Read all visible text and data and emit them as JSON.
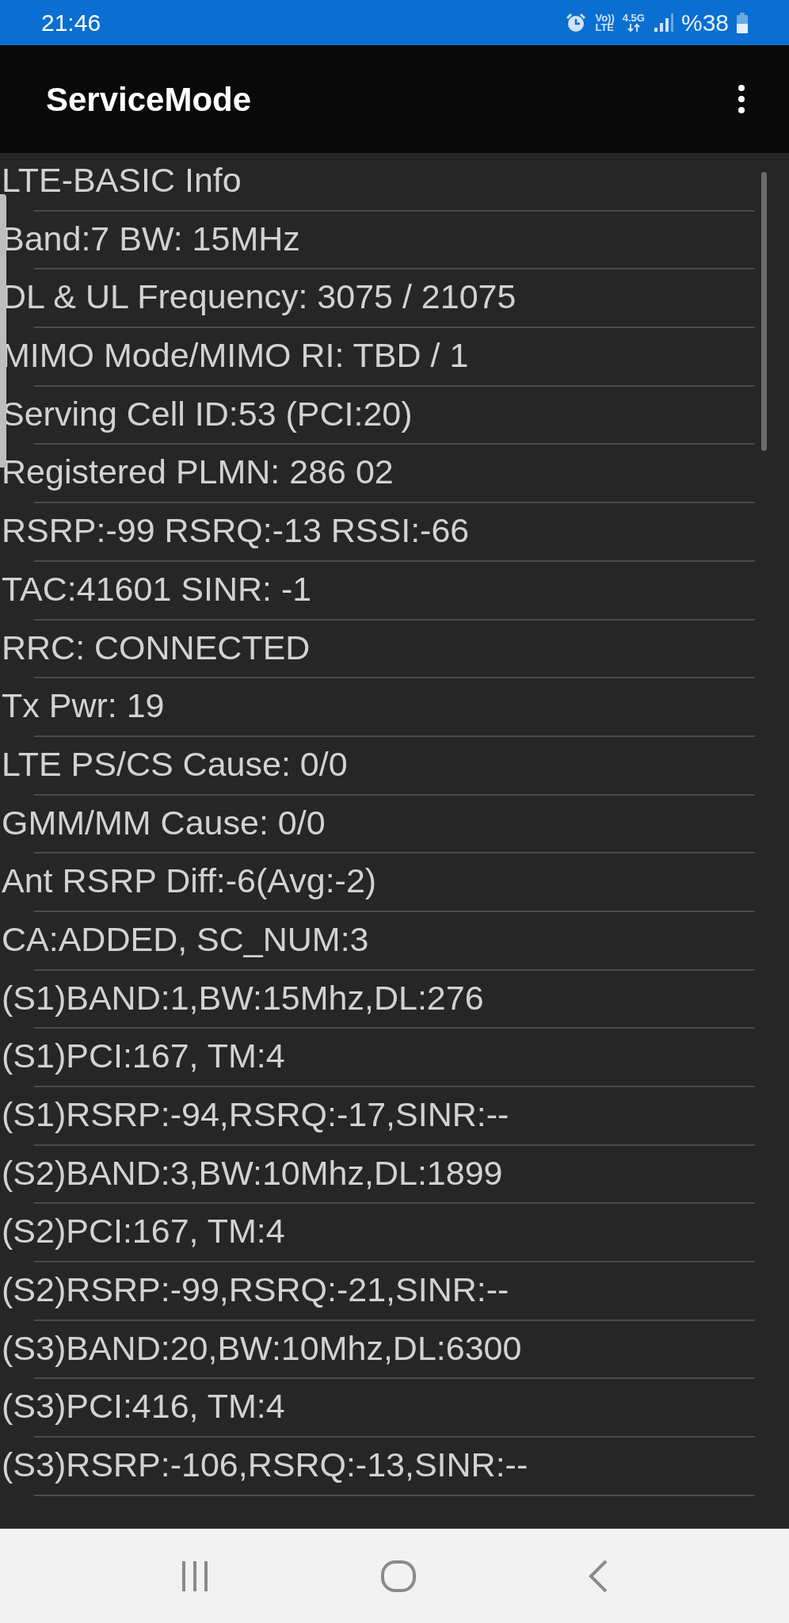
{
  "status_bar": {
    "time": "21:46",
    "volte_top": "Vo))",
    "volte_bottom": "LTE",
    "network": "4.5G",
    "battery": "%38"
  },
  "app_bar": {
    "title": "ServiceMode"
  },
  "info_rows": [
    "LTE-BASIC Info",
    "Band:7 BW: 15MHz",
    "DL & UL Frequency: 3075 / 21075",
    "MIMO Mode/MIMO RI: TBD / 1",
    "Serving Cell ID:53 (PCI:20)",
    "Registered PLMN: 286 02",
    "RSRP:-99 RSRQ:-13 RSSI:-66",
    "TAC:41601 SINR: -1",
    "RRC: CONNECTED",
    "Tx Pwr: 19",
    "LTE PS/CS Cause: 0/0",
    "GMM/MM Cause: 0/0",
    "Ant RSRP Diff:-6(Avg:-2)",
    "CA:ADDED, SC_NUM:3",
    "(S1)BAND:1,BW:15Mhz,DL:276",
    "(S1)PCI:167, TM:4",
    "(S1)RSRP:-94,RSRQ:-17,SINR:--",
    "(S2)BAND:3,BW:10Mhz,DL:1899",
    "(S2)PCI:167, TM:4",
    "(S2)RSRP:-99,RSRQ:-21,SINR:--",
    "(S3)BAND:20,BW:10Mhz,DL:6300",
    "(S3)PCI:416, TM:4",
    "(S3)RSRP:-106,RSRQ:-13,SINR:--"
  ]
}
